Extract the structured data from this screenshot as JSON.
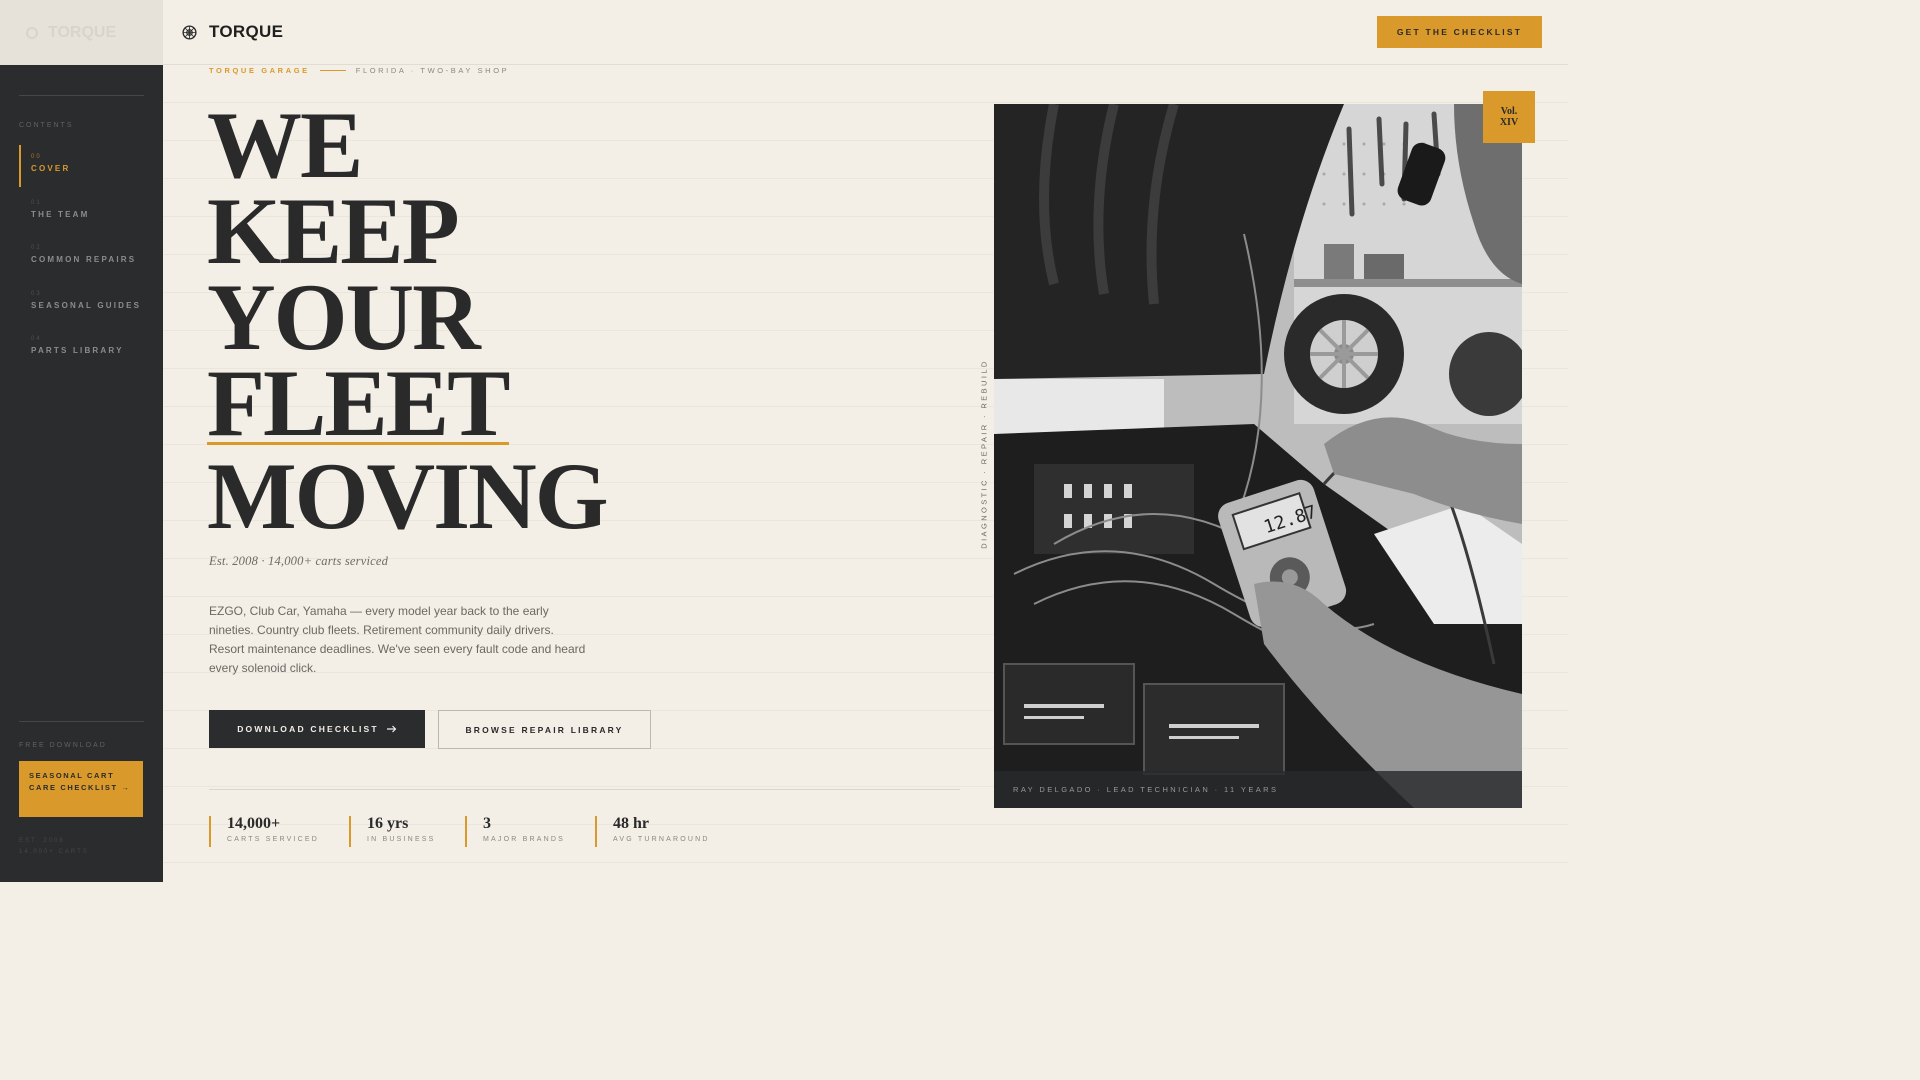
{
  "sidebar": {
    "top_label": "TORQUE",
    "contents_label": "CONTENTS",
    "items": [
      {
        "num": "00",
        "label": "COVER",
        "active": true
      },
      {
        "num": "01",
        "label": "THE TEAM",
        "active": false
      },
      {
        "num": "02",
        "label": "COMMON REPAIRS",
        "active": false
      },
      {
        "num": "03",
        "label": "SEASONAL GUIDES",
        "active": false
      },
      {
        "num": "04",
        "label": "PARTS LIBRARY",
        "active": false
      }
    ],
    "download_label": "FREE DOWNLOAD",
    "download_cta": "SEASONAL CART CARE CHECKLIST →",
    "footer_line1": "EST. 2008",
    "footer_line2": "14,000+ CARTS"
  },
  "header": {
    "brand": "TORQUE",
    "cta": "GET THE CHECKLIST"
  },
  "hero": {
    "kicker_primary": "TORQUE GARAGE",
    "kicker_secondary": "FLORIDA · TWO-BAY SHOP",
    "headline": [
      "WE",
      "KEEP",
      "YOUR",
      "FLEET",
      "MOVING"
    ],
    "est": "Est. 2008 · 14,000+ carts serviced",
    "body": "EZGO, Club Car, Yamaha — every model year back to the early nineties. Country club fleets. Retirement community daily drivers. Resort maintenance deadlines. We've seen every fault code and heard every solenoid click.",
    "primary_button": "DOWNLOAD CHECKLIST",
    "secondary_button": "BROWSE REPAIR LIBRARY"
  },
  "stats": [
    {
      "value": "14,000+",
      "label": "CARTS SERVICED"
    },
    {
      "value": "16 yrs",
      "label": "IN BUSINESS"
    },
    {
      "value": "3",
      "label": "MAJOR BRANDS"
    },
    {
      "value": "48 hr",
      "label": "AVG TURNAROUND"
    }
  ],
  "photo": {
    "vertical_tag": "DIAGNOSTIC · REPAIR · REBUILD",
    "caption": "RAY DELGADO · LEAD TECHNICIAN · 11 YEARS",
    "badge_line1": "Vol.",
    "badge_line2": "XIV",
    "meter_reading": "12.87"
  },
  "colors": {
    "accent": "#d99a2b",
    "dark": "#2b2c2e",
    "paper": "#f3efe7"
  },
  "icons": {
    "brand": "gear-icon",
    "primary_button": "arrow-right-icon"
  }
}
